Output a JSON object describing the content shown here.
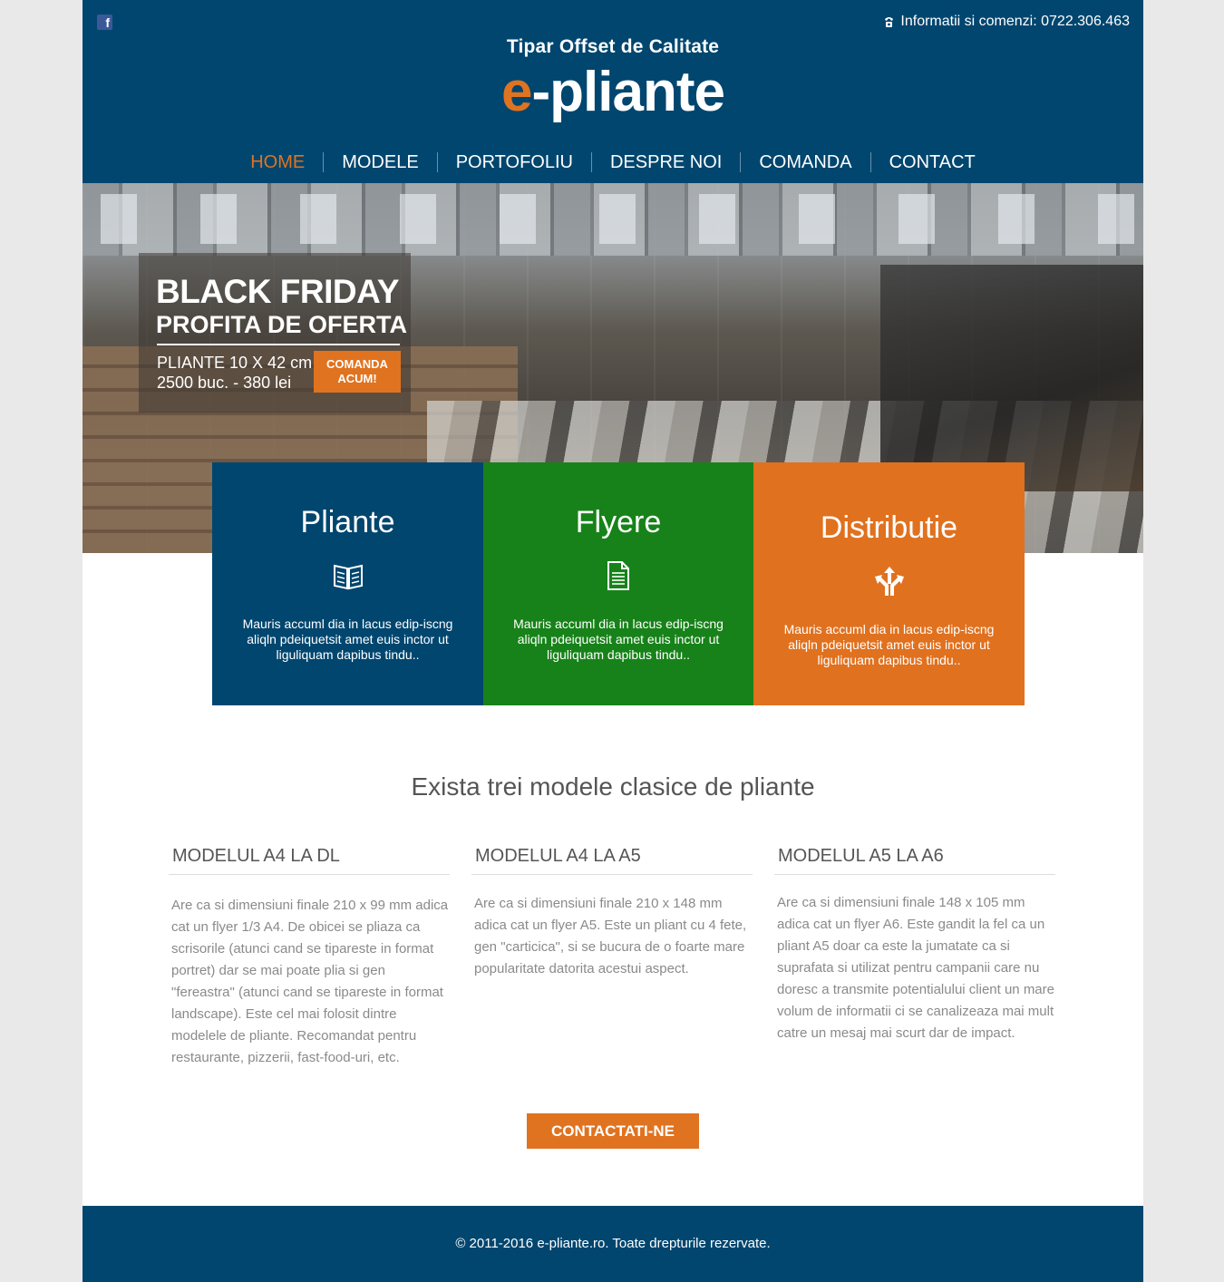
{
  "header": {
    "facebook_icon": "facebook-icon",
    "contact_label": "Informatii si comenzi: 0722.306.463",
    "phone_icon": "phone-icon",
    "tagline": "Tipar Offset de Calitate",
    "logo_e": "e",
    "logo_rest": "-pliante",
    "accent_color": "#e07320",
    "background_color": "#01466f"
  },
  "nav": {
    "items": [
      {
        "label": "HOME",
        "active": true
      },
      {
        "label": "MODELE"
      },
      {
        "label": "PORTOFOLIU"
      },
      {
        "label": "DESPRE NOI"
      },
      {
        "label": "COMANDA"
      },
      {
        "label": "CONTACT"
      }
    ]
  },
  "hero": {
    "title": "BLACK FRIDAY",
    "subtitle": "PROFITA DE OFERTA",
    "offer_line1": "PLIANTE 10 X 42 cm",
    "offer_line2": "2500 buc. - 380 lei",
    "button_line1": "COMANDA",
    "button_line2": "ACUM!"
  },
  "features": [
    {
      "title": "Pliante",
      "icon": "open-book-icon",
      "text": "Mauris accuml dia in lacus edip-iscng aliqln pdeiquetsit amet euis inctor ut liguliquam dapibus tindu..",
      "color": "#01466f"
    },
    {
      "title": "Flyere",
      "icon": "document-icon",
      "text": "Mauris accuml dia in lacus edip-iscng aliqln pdeiquetsit amet euis inctor ut liguliquam dapibus tindu..",
      "color": "#178219"
    },
    {
      "title": "Distributie",
      "icon": "split-arrows-icon",
      "text": "Mauris accuml dia in lacus edip-iscng aliqln pdeiquetsit amet euis inctor ut liguliquam dapibus tindu..",
      "color": "#e0711f"
    }
  ],
  "models": {
    "title": "Exista trei modele clasice de pliante",
    "items": [
      {
        "heading": "MODELUL A4 LA DL",
        "text": "Are ca si dimensiuni finale 210 x 99 mm adica cat un flyer 1/3 A4. De obicei se pliaza ca scrisorile (atunci cand se tipareste in format portret) dar se mai poate plia si gen \"fereastra\" (atunci cand se tipareste in format landscape). Este cel mai folosit dintre modelele de pliante. Recomandat pentru restaurante, pizzerii, fast-food-uri, etc."
      },
      {
        "heading": "MODELUL A4 LA A5",
        "text": "Are ca si dimensiuni finale 210 x 148 mm adica cat un flyer A5. Este un pliant cu 4 fete, gen \"carticica\", si se bucura de o foarte mare popularitate datorita acestui aspect."
      },
      {
        "heading": "MODELUL A5 LA A6",
        "text": "Are ca si dimensiuni finale 148 x 105 mm adica cat un flyer A6. Este gandit la fel ca un pliant A5 doar ca este la jumatate ca si suprafata si utilizat pentru campanii care nu doresc a transmite potentialului client un mare volum de informatii ci se canalizeaza mai mult catre un mesaj mai scurt dar de impact."
      }
    ],
    "button": "CONTACTATI-NE"
  },
  "footer": {
    "text": "© 2011-2016 e-pliante.ro. Toate drepturile rezervate."
  }
}
